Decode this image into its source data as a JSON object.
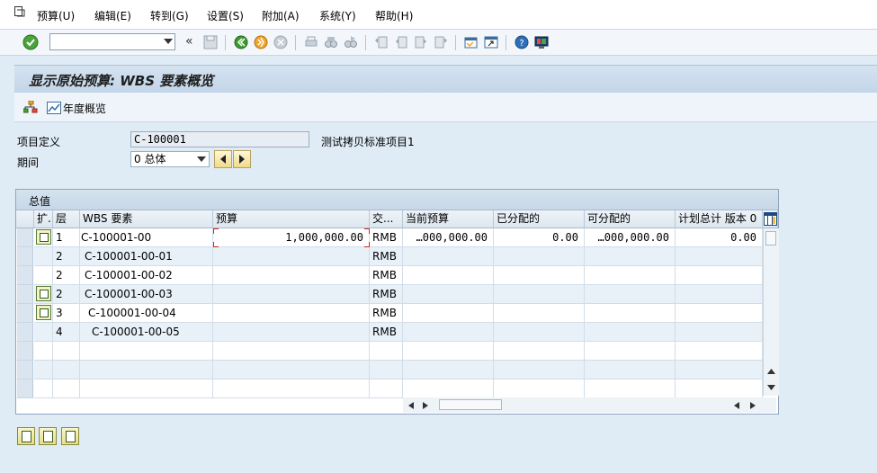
{
  "menubar": {
    "items": [
      "预算(U)",
      "编辑(E)",
      "转到(G)",
      "设置(S)",
      "附加(A)",
      "系统(Y)",
      "帮助(H)"
    ]
  },
  "toolbar": {
    "command_value": "",
    "back_glyph": "«",
    "icons": [
      "ok-icon",
      "save-icon",
      "back-icon",
      "exit-icon",
      "cancel-icon",
      "print-icon",
      "find-icon",
      "find-next-icon",
      "first-page-icon",
      "previous-page-icon",
      "next-page-icon",
      "last-page-icon",
      "create-session-icon",
      "shortcut-icon",
      "help-icon",
      "customize-layout-icon"
    ]
  },
  "title": "显示原始预算: WBS 要素概览",
  "app_toolbar": {
    "annual_overview_label": "年度概览"
  },
  "form": {
    "project_def_label": "项目定义",
    "project_def_value": "C-100001",
    "project_desc": "测试拷贝标准项目1",
    "period_label": "期间",
    "period_value": "0 总体"
  },
  "grid": {
    "title": "总值",
    "headers": [
      "扩.",
      "层",
      "WBS 要素",
      "预算",
      "交...",
      "当前预算",
      "已分配的",
      "可分配的",
      "计划总计 版本 0"
    ],
    "rows": [
      {
        "expand": true,
        "level": "1",
        "wbs": "C-100001-00",
        "budget": "1,000,000.00",
        "currency": "RMB",
        "current": "…000,000.00",
        "distributed": "0.00",
        "distributable": "…000,000.00",
        "plan_total": "0.00"
      },
      {
        "expand": false,
        "level": "2",
        "wbs": "C-100001-00-01",
        "budget": "",
        "currency": "RMB",
        "current": "",
        "distributed": "",
        "distributable": "",
        "plan_total": ""
      },
      {
        "expand": false,
        "level": "2",
        "wbs": "C-100001-00-02",
        "budget": "",
        "currency": "RMB",
        "current": "",
        "distributed": "",
        "distributable": "",
        "plan_total": ""
      },
      {
        "expand": true,
        "level": "2",
        "wbs": "C-100001-00-03",
        "budget": "",
        "currency": "RMB",
        "current": "",
        "distributed": "",
        "distributable": "",
        "plan_total": ""
      },
      {
        "expand": true,
        "level": "3",
        "wbs": "C-100001-00-04",
        "budget": "",
        "currency": "RMB",
        "current": "",
        "distributed": "",
        "distributable": "",
        "plan_total": ""
      },
      {
        "expand": false,
        "level": "4",
        "wbs": "C-100001-00-05",
        "budget": "",
        "currency": "RMB",
        "current": "",
        "distributed": "",
        "distributable": "",
        "plan_total": ""
      },
      {
        "expand": false,
        "level": "",
        "wbs": "",
        "budget": "",
        "currency": "",
        "current": "",
        "distributed": "",
        "distributable": "",
        "plan_total": ""
      },
      {
        "expand": false,
        "level": "",
        "wbs": "",
        "budget": "",
        "currency": "",
        "current": "",
        "distributed": "",
        "distributable": "",
        "plan_total": ""
      },
      {
        "expand": false,
        "level": "",
        "wbs": "",
        "budget": "",
        "currency": "",
        "current": "",
        "distributed": "",
        "distributable": "",
        "plan_total": ""
      }
    ]
  },
  "colors": {
    "background": "#dfebf5",
    "title_bar": "#c6d7e8",
    "row_alt": "#e8f0f8",
    "focus_marker": "#d0281e"
  }
}
